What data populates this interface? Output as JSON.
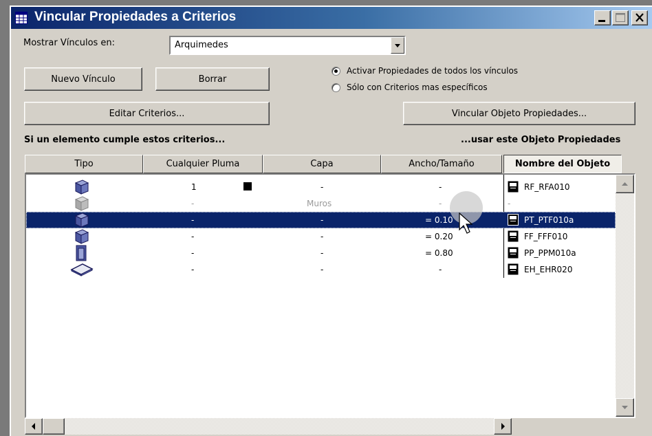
{
  "window": {
    "title": "Vincular Propiedades a Criterios",
    "controls": [
      "minimize-icon",
      "maximize-icon",
      "close-icon"
    ]
  },
  "show_links": {
    "label": "Mostrar Vínculos en:",
    "selected": "Arquimedes"
  },
  "buttons": {
    "new_link": "Nuevo Vínculo",
    "delete": "Borrar",
    "edit_criteria": "Editar Criterios...",
    "link_object": "Vincular Objeto Propiedades..."
  },
  "radios": {
    "all_links": "Activar Propiedades de todos los vínculos",
    "specific": "Sólo con Criterios mas específicos",
    "selected": "all_links"
  },
  "section": {
    "left": "Si un elemento cumple estos criterios...",
    "right": "...usar este Objeto Propiedades"
  },
  "columns": [
    "Tipo",
    "Cualquier Pluma",
    "Capa",
    "Ancho/Tamaño",
    "Nombre del Objeto"
  ],
  "rows": [
    {
      "type_icon": "slab-icon",
      "pen": "1",
      "pen_swatch": "#000000",
      "layer": "-",
      "width": "-",
      "object": "RF_RFA010"
    },
    {
      "type_icon": "slab-grey-icon",
      "pen": "-",
      "layer": "Muros",
      "width": "-",
      "object": "-"
    },
    {
      "type_icon": "slab-icon",
      "pen": "-",
      "layer": "-",
      "width": "= 0.10",
      "object": "PT_PTF010a"
    },
    {
      "type_icon": "slab-icon",
      "pen": "-",
      "layer": "-",
      "width": "= 0.20",
      "object": "FF_FFF010"
    },
    {
      "type_icon": "door-icon",
      "pen": "-",
      "layer": "-",
      "width": "= 0.80",
      "object": "PP_PPM010a"
    },
    {
      "type_icon": "floor-tile-icon",
      "pen": "-",
      "layer": "-",
      "width": "-",
      "object": "EH_EHR020"
    }
  ],
  "selected_row": 2,
  "colors": {
    "title_bar": "#0a246a",
    "selection": "#0a246a",
    "face": "#d4d0c8"
  }
}
